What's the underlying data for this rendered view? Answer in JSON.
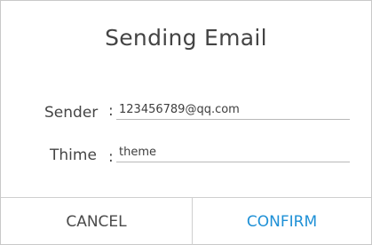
{
  "dialog": {
    "title": "Sending Email",
    "fields": {
      "sender": {
        "label": "Sender",
        "colon": ":",
        "value": "123456789@qq.com"
      },
      "theme": {
        "label": "Thime",
        "colon": ":",
        "value": "theme"
      }
    },
    "buttons": {
      "cancel": "CANCEL",
      "confirm": "CONFIRM"
    }
  },
  "colors": {
    "confirm_accent": "#1e90d6",
    "border": "#c9c9c9",
    "text": "#454545"
  }
}
